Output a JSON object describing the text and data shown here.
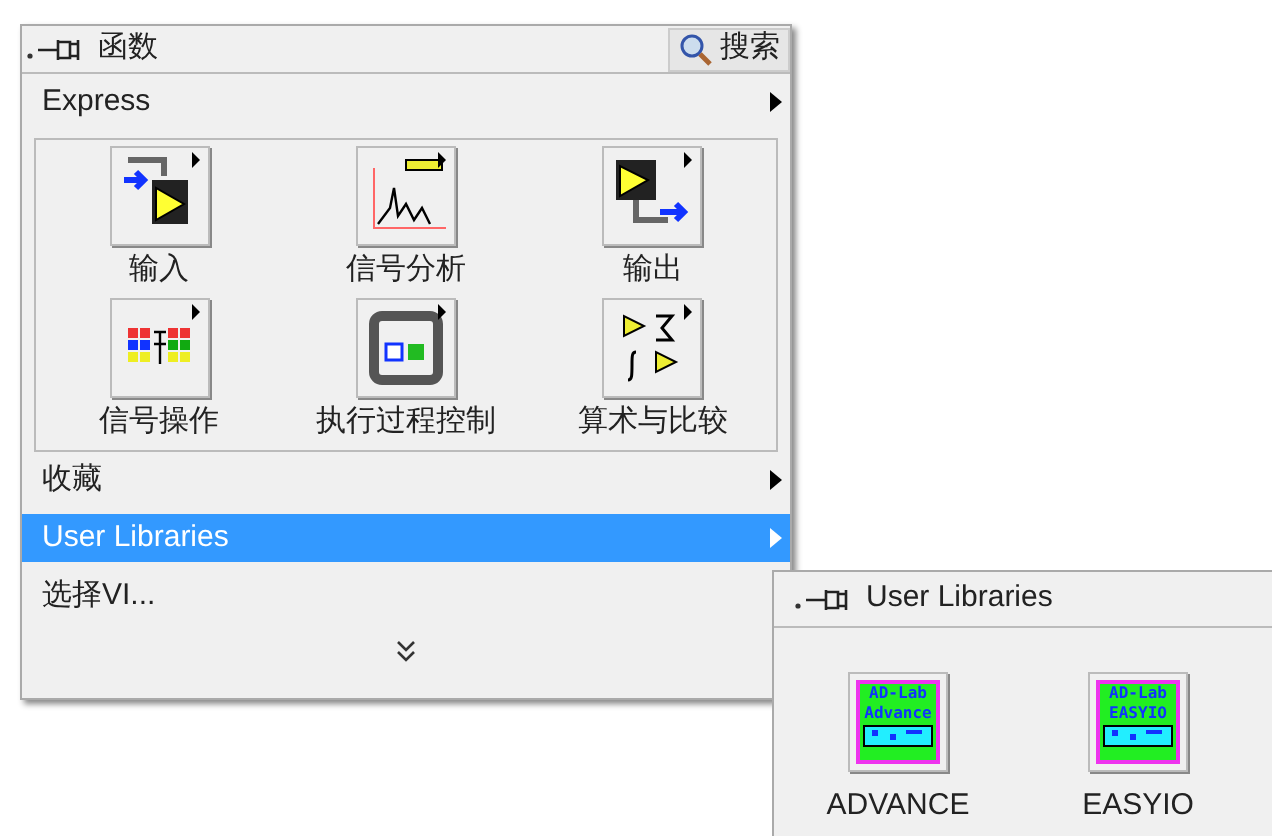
{
  "palette": {
    "title": "函数",
    "search_button": "搜索",
    "express": {
      "label": "Express",
      "submenu": true,
      "selected": false
    },
    "express_items": [
      {
        "label": "输入",
        "kind": "input"
      },
      {
        "label": "信号分析",
        "kind": "analysis"
      },
      {
        "label": "输出",
        "kind": "output"
      },
      {
        "label": "信号操作",
        "kind": "manipulation"
      },
      {
        "label": "执行过程控制",
        "kind": "loop"
      },
      {
        "label": "算术与比较",
        "kind": "arithmetic"
      }
    ],
    "menu_items": [
      {
        "label": "收藏",
        "submenu": true,
        "selected": false
      },
      {
        "label": "User Libraries",
        "submenu": true,
        "selected": true
      },
      {
        "label": "选择VI...",
        "submenu": false,
        "selected": false
      }
    ]
  },
  "submenu": {
    "title": "User Libraries",
    "items": [
      {
        "label": "ADVANCE",
        "icon_lines": [
          "AD-Lab",
          "Advance"
        ]
      },
      {
        "label": "EASYIO",
        "icon_lines": [
          "AD-Lab",
          "EASYIO"
        ]
      }
    ]
  }
}
